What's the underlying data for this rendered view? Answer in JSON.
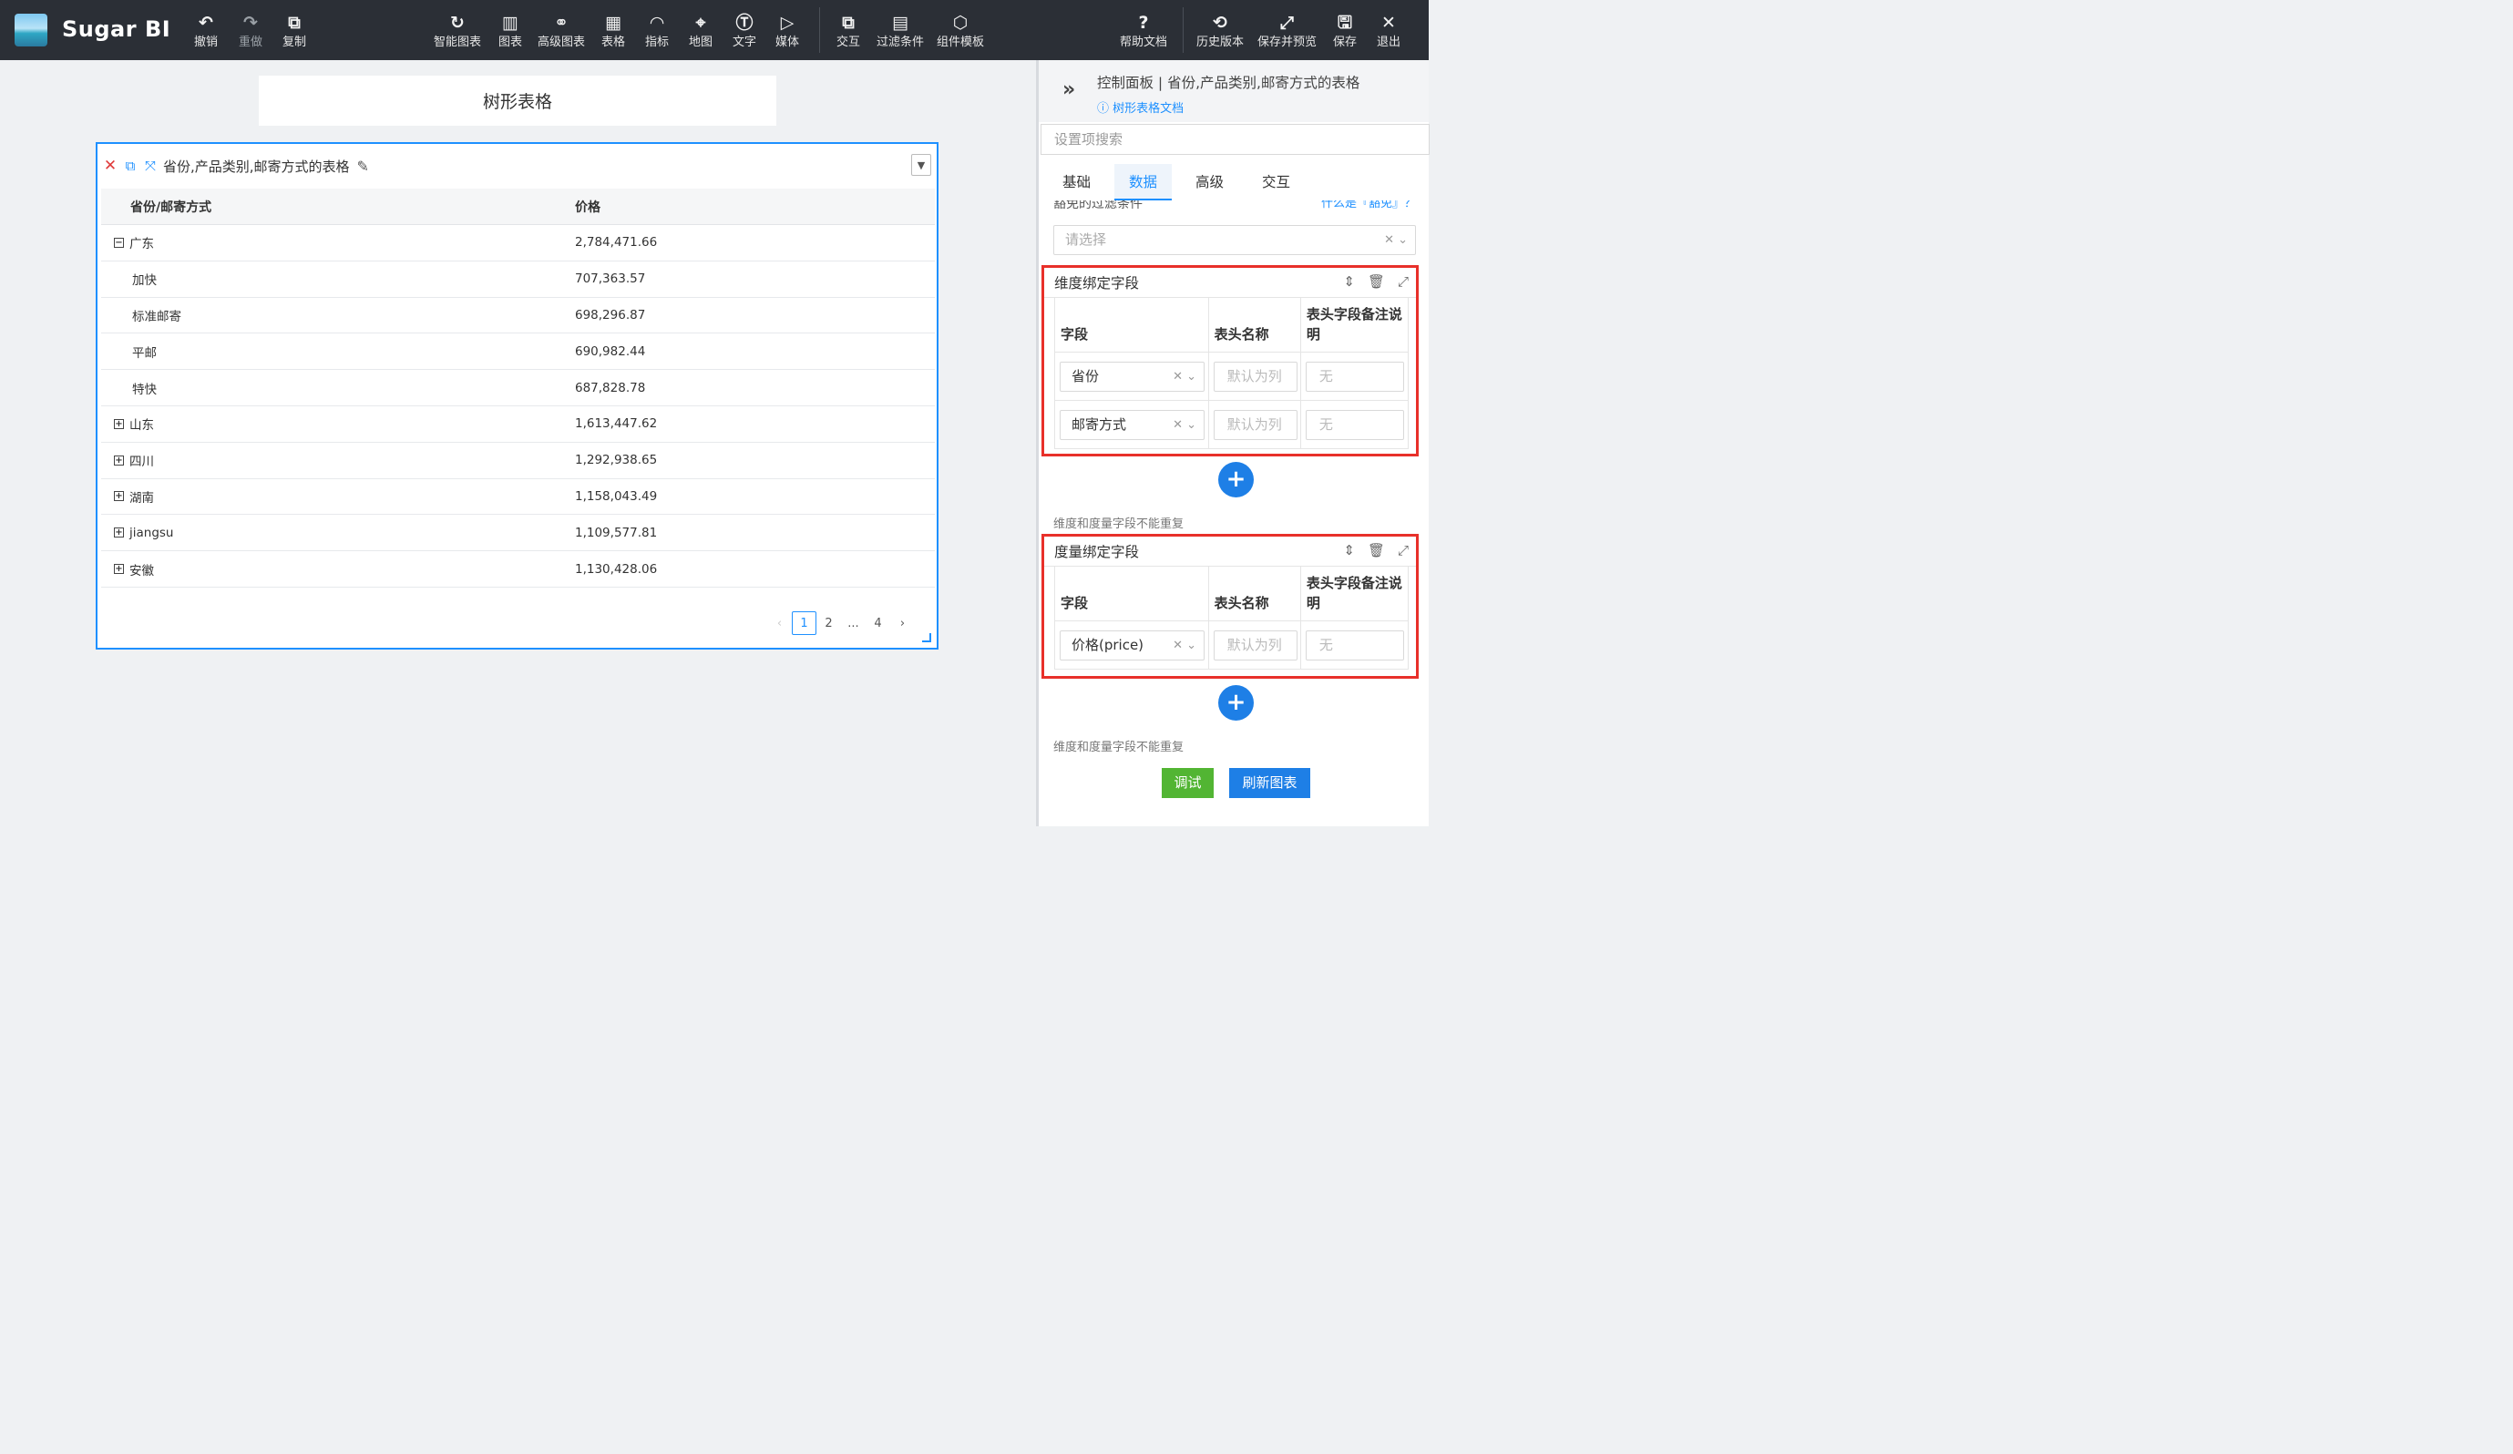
{
  "app": {
    "name": "Sugar BI"
  },
  "toolbar": {
    "left": [
      {
        "icon": "undo-icon",
        "glyph": "↶",
        "label": "撤销"
      },
      {
        "icon": "redo-icon",
        "glyph": "↷",
        "label": "重做"
      },
      {
        "icon": "copy-icon",
        "glyph": "⧉",
        "label": "复制"
      }
    ],
    "center": [
      {
        "icon": "smart-chart-icon",
        "glyph": "↻",
        "label": "智能图表"
      },
      {
        "icon": "bar-chart-icon",
        "glyph": "▥",
        "label": "图表"
      },
      {
        "icon": "advanced-chart-icon",
        "glyph": "⚭",
        "label": "高级图表"
      },
      {
        "icon": "table-icon",
        "glyph": "▦",
        "label": "表格"
      },
      {
        "icon": "gauge-icon",
        "glyph": "◠",
        "label": "指标"
      },
      {
        "icon": "map-pin-icon",
        "glyph": "⌖",
        "label": "地图"
      },
      {
        "icon": "text-icon",
        "glyph": "Ⓣ",
        "label": "文字"
      },
      {
        "icon": "media-icon",
        "glyph": "▷",
        "label": "媒体"
      }
    ],
    "center2": [
      {
        "icon": "interaction-icon",
        "glyph": "⧉",
        "label": "交互"
      },
      {
        "icon": "filter-icon",
        "glyph": "▤",
        "label": "过滤条件"
      },
      {
        "icon": "template-icon",
        "glyph": "⬡",
        "label": "组件模板"
      }
    ],
    "right1": [
      {
        "icon": "help-icon",
        "glyph": "?",
        "label": "帮助文档"
      }
    ],
    "right2": [
      {
        "icon": "history-icon",
        "glyph": "⟲",
        "label": "历史版本"
      },
      {
        "icon": "expand-icon",
        "glyph": "⤢",
        "label": "保存并预览"
      },
      {
        "icon": "save-icon",
        "glyph": "🖫",
        "label": "保存"
      },
      {
        "icon": "exit-icon",
        "glyph": "✕",
        "label": "退出"
      }
    ]
  },
  "canvas": {
    "title": "树形表格",
    "card": {
      "title": "省份,产品类别,邮寄方式的表格",
      "columns": [
        "省份/邮寄方式",
        "价格"
      ],
      "rows": [
        {
          "toggle": "−",
          "name": "广东",
          "value": "2,784,471.66",
          "child": false
        },
        {
          "toggle": "",
          "name": "加快",
          "value": "707,363.57",
          "child": true
        },
        {
          "toggle": "",
          "name": "标准邮寄",
          "value": "698,296.87",
          "child": true
        },
        {
          "toggle": "",
          "name": "平邮",
          "value": "690,982.44",
          "child": true
        },
        {
          "toggle": "",
          "name": "特快",
          "value": "687,828.78",
          "child": true
        },
        {
          "toggle": "+",
          "name": "山东",
          "value": "1,613,447.62",
          "child": false
        },
        {
          "toggle": "+",
          "name": "四川",
          "value": "1,292,938.65",
          "child": false
        },
        {
          "toggle": "+",
          "name": "湖南",
          "value": "1,158,043.49",
          "child": false
        },
        {
          "toggle": "+",
          "name": "jiangsu",
          "value": "1,109,577.81",
          "child": false
        },
        {
          "toggle": "+",
          "name": "安徽",
          "value": "1,130,428.06",
          "child": false
        }
      ],
      "pager": {
        "prev": "‹",
        "pages": [
          "1",
          "2",
          "...",
          "4"
        ],
        "next": "›",
        "current": "1"
      }
    }
  },
  "panel": {
    "title": "控制面板 | 省份,产品类别,邮寄方式的表格",
    "doc_link": "ⓘ 树形表格文档",
    "search_placeholder": "设置项搜索",
    "tabs": [
      "基础",
      "数据",
      "高级",
      "交互"
    ],
    "active_tab": "数据",
    "filter_label": "豁免的过滤条件",
    "filter_link": "什么是『豁免』？",
    "filter_placeholder": "请选择",
    "dimension": {
      "title": "维度绑定字段",
      "headers": [
        "字段",
        "表头名称",
        "表头字段备注说明"
      ],
      "rows": [
        {
          "field": "省份",
          "name_placeholder": "默认为列",
          "note_placeholder": "无"
        },
        {
          "field": "邮寄方式",
          "name_placeholder": "默认为列",
          "note_placeholder": "无"
        }
      ]
    },
    "measure": {
      "title": "度量绑定字段",
      "headers": [
        "字段",
        "表头名称",
        "表头字段备注说明"
      ],
      "rows": [
        {
          "field": "价格(price)",
          "name_placeholder": "默认为列",
          "note_placeholder": "无"
        }
      ]
    },
    "note": "维度和度量字段不能重复",
    "debug_button": "调试",
    "refresh_button": "刷新图表"
  }
}
